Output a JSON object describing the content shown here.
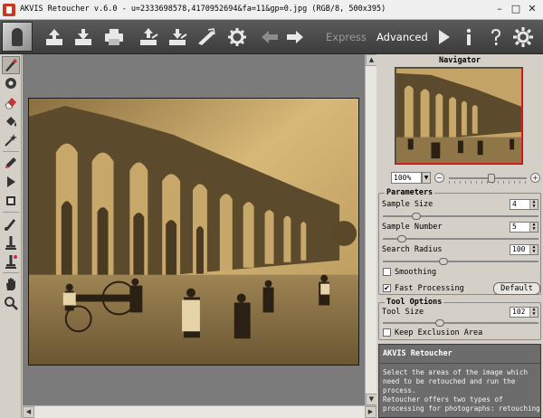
{
  "window": {
    "title": "AKVIS Retoucher v.6.0 - u=2333698578,4170952694&fa=11&gp=0.jpg (RGB/8, 500x395)",
    "minimize": "–",
    "maximize": "□",
    "close": "✕"
  },
  "toolbar": {
    "icons": [
      "open-icon",
      "save-icon",
      "print-icon",
      "import-icon",
      "export-icon",
      "brush-icon",
      "settings-gear-icon",
      "back-arrow-icon",
      "forward-arrow-icon",
      "play-icon",
      "info-icon",
      "help-icon",
      "preferences-gear-icon"
    ],
    "mode_express": "Express",
    "mode_advanced": "Advanced",
    "info_label": "i",
    "help_label": "?"
  },
  "left_tools": [
    "selection-brush-icon",
    "stamp-icon",
    "eraser-icon",
    "fill-icon",
    "magic-wand-icon",
    "pencil-icon",
    "run-icon",
    "crop-icon",
    "clone-icon",
    "eyedropper-icon",
    "clone-stamp-icon",
    "hand-icon",
    "zoom-icon"
  ],
  "navigator": {
    "title": "Navigator",
    "zoom_value": "100%",
    "zoom_minus": "−",
    "zoom_plus": "+",
    "zoom_level_fraction": 0.55
  },
  "parameters": {
    "title": "Parameters",
    "sample_size_label": "Sample Size",
    "sample_size_value": "4",
    "sample_size_fraction": 0.2,
    "sample_number_label": "Sample Number",
    "sample_number_value": "5",
    "sample_number_fraction": 0.1,
    "search_radius_label": "Search Radius",
    "search_radius_value": "100",
    "search_radius_fraction": 0.38,
    "smoothing_label": "Smoothing",
    "fast_processing_label": "Fast Processing",
    "fast_processing_checked": true,
    "default_button": "Default"
  },
  "tool_options": {
    "title": "Tool Options",
    "tool_size_label": "Tool Size",
    "tool_size_value": "102",
    "tool_size_fraction": 0.36,
    "keep_exclusion_label": "Keep Exclusion Area"
  },
  "help": {
    "title": "AKVIS Retoucher",
    "lines": [
      "Select the areas of the image which",
      "need to be retouched and run the",
      "process.",
      "Retoucher offers two types of",
      "processing for photographs: retouching"
    ]
  },
  "colors": {
    "toolbar_bg": "#4a4a4a",
    "panel_bg": "#d4d0c8",
    "canvas_bg": "#7b7b7b",
    "help_bg": "#6c6c6c",
    "photo_sepia": "#b89a62"
  }
}
